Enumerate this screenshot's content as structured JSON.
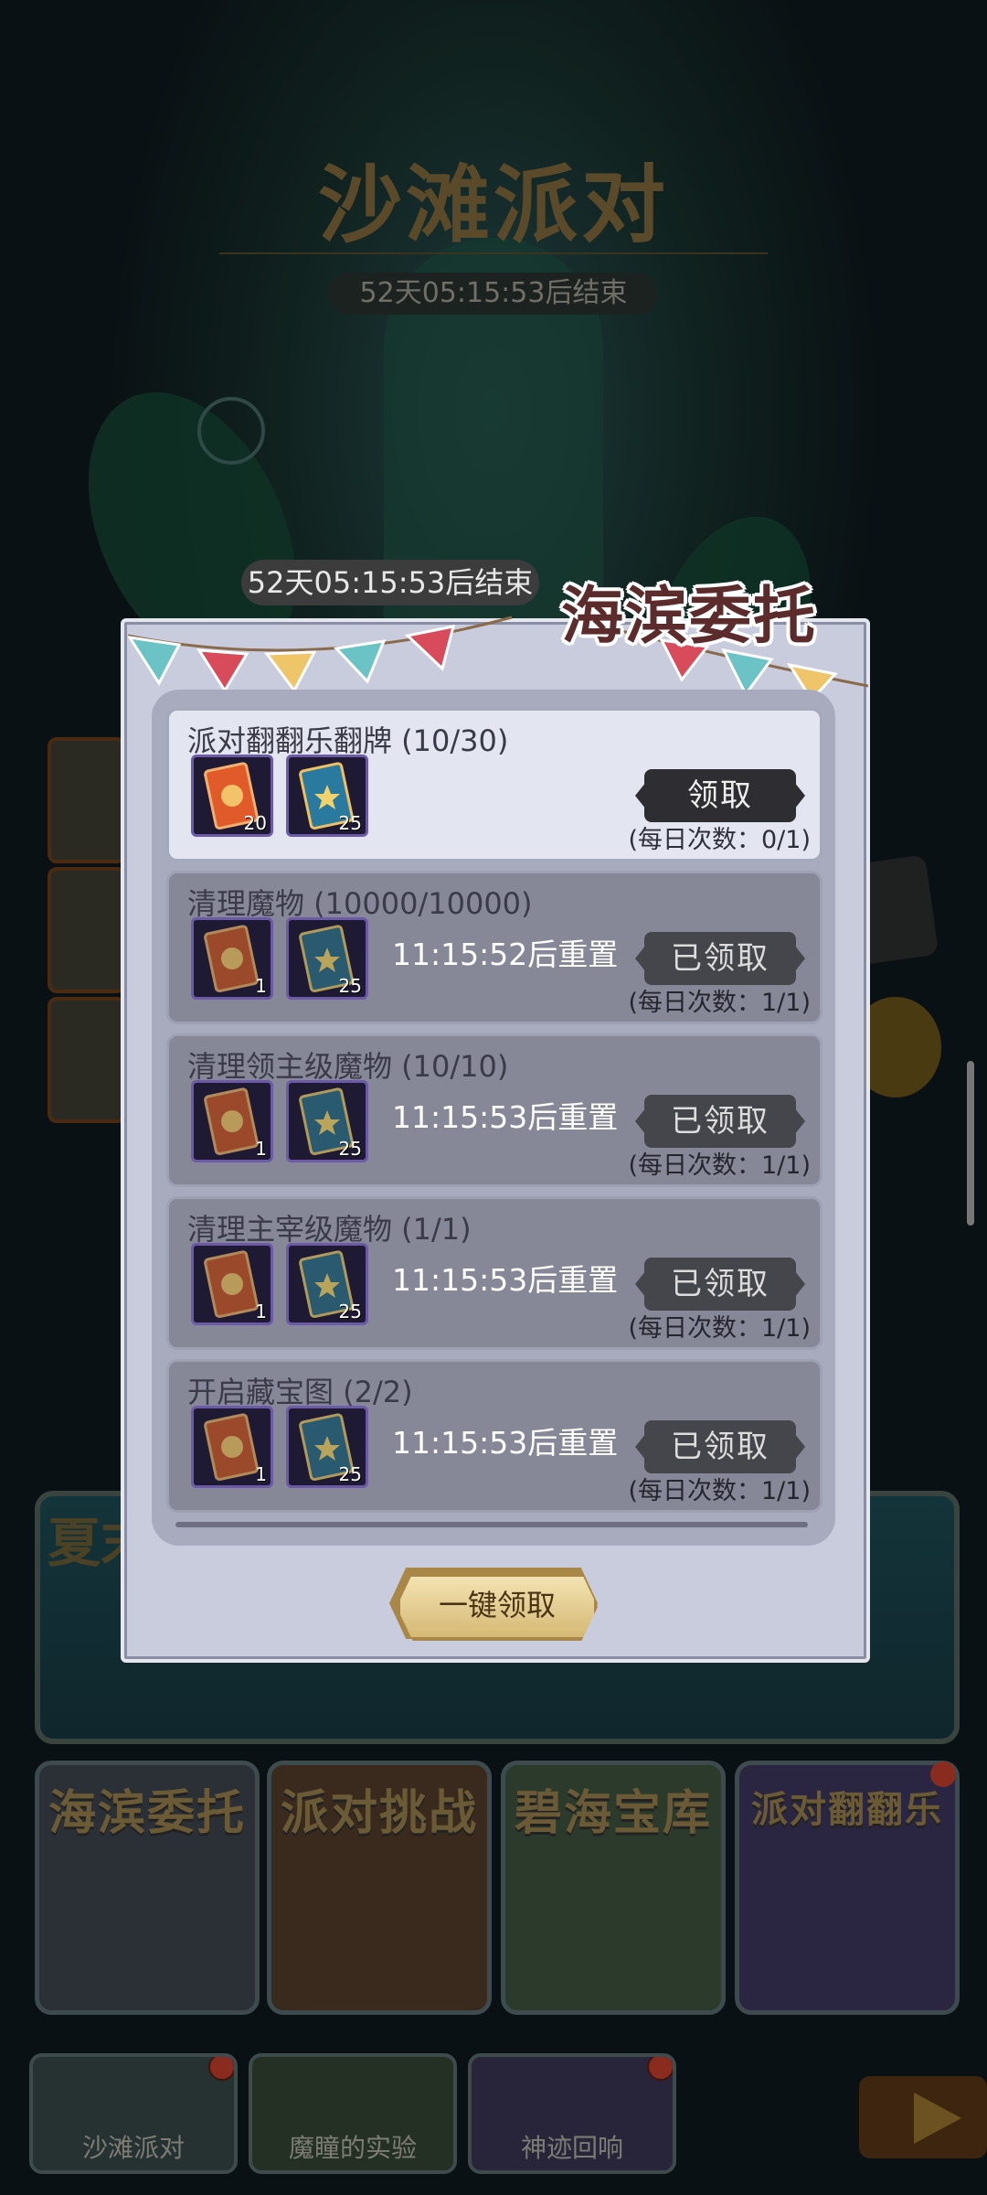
{
  "background": {
    "title": "沙滩派对",
    "timer": "52天05:15:53后结束",
    "banner_text": "夏末",
    "cards": [
      "海滨委托",
      "派对挑战",
      "碧海宝库",
      "派对翻翻乐"
    ],
    "tabs": [
      "沙滩派对",
      "魔瞳的实验",
      "神迹回响"
    ]
  },
  "modal": {
    "floating_timer": "52天05:15:53后结束",
    "title": "海滨委托",
    "tasks": [
      {
        "name": "派对翻翻乐翻牌 (10/30)",
        "items": [
          {
            "icon": "red-card-icon",
            "qty": "20"
          },
          {
            "icon": "blue-card-icon",
            "qty": "25"
          }
        ],
        "reset": "",
        "button": "领取",
        "daily": "(每日次数：0/1)"
      },
      {
        "name": "清理魔物 (10000/10000)",
        "items": [
          {
            "icon": "red-card-icon",
            "qty": "1"
          },
          {
            "icon": "blue-card-icon",
            "qty": "25"
          }
        ],
        "reset": "11:15:52后重置",
        "button": "已领取",
        "daily": "(每日次数：1/1)"
      },
      {
        "name": "清理领主级魔物 (10/10)",
        "items": [
          {
            "icon": "red-card-icon",
            "qty": "1"
          },
          {
            "icon": "blue-card-icon",
            "qty": "25"
          }
        ],
        "reset": "11:15:53后重置",
        "button": "已领取",
        "daily": "(每日次数：1/1)"
      },
      {
        "name": "清理主宰级魔物 (1/1)",
        "items": [
          {
            "icon": "red-card-icon",
            "qty": "1"
          },
          {
            "icon": "blue-card-icon",
            "qty": "25"
          }
        ],
        "reset": "11:15:53后重置",
        "button": "已领取",
        "daily": "(每日次数：1/1)"
      },
      {
        "name": "开启藏宝图 (2/2)",
        "items": [
          {
            "icon": "red-card-icon",
            "qty": "1"
          },
          {
            "icon": "blue-card-icon",
            "qty": "25"
          }
        ],
        "reset": "11:15:53后重置",
        "button": "已领取",
        "daily": "(每日次数：1/1)"
      }
    ],
    "claim_all": "一键领取"
  },
  "colors": {
    "modal_bg": "#c8ccdc",
    "title_color": "#5c2c2c",
    "claim_all_gold": "#d5b874"
  }
}
